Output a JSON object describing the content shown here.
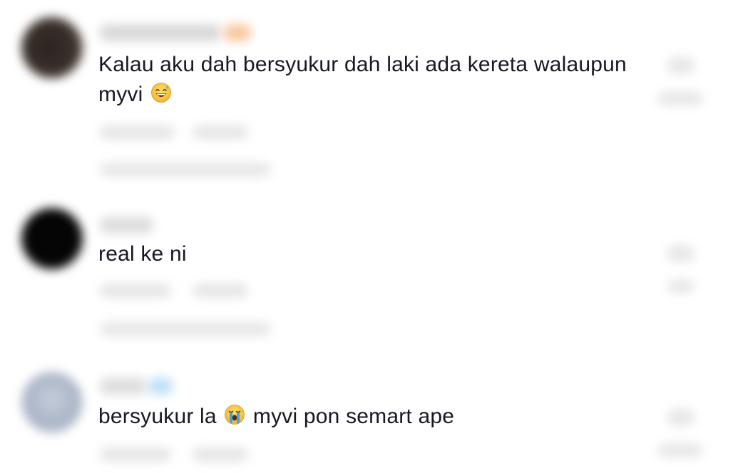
{
  "comments": [
    {
      "text_before_emoji": "Kalau aku dah bersyukur dah laki ada kereta walaupun myvi",
      "emoji": "grinning-face-with-sweat-icon",
      "text_after_emoji": "",
      "avatar_color": "#3a302a"
    },
    {
      "text_before_emoji": "real ke ni",
      "emoji": "",
      "text_after_emoji": "",
      "avatar_color": "#050505"
    },
    {
      "text_before_emoji": "bersyukur la",
      "emoji": "loudly-crying-face-icon",
      "text_after_emoji": "myvi pon semart ape",
      "avatar_color": "#aab4c6"
    }
  ],
  "colors": {
    "text": "#161823",
    "blurred_meta": "#e3e3e3",
    "background": "#ffffff"
  }
}
